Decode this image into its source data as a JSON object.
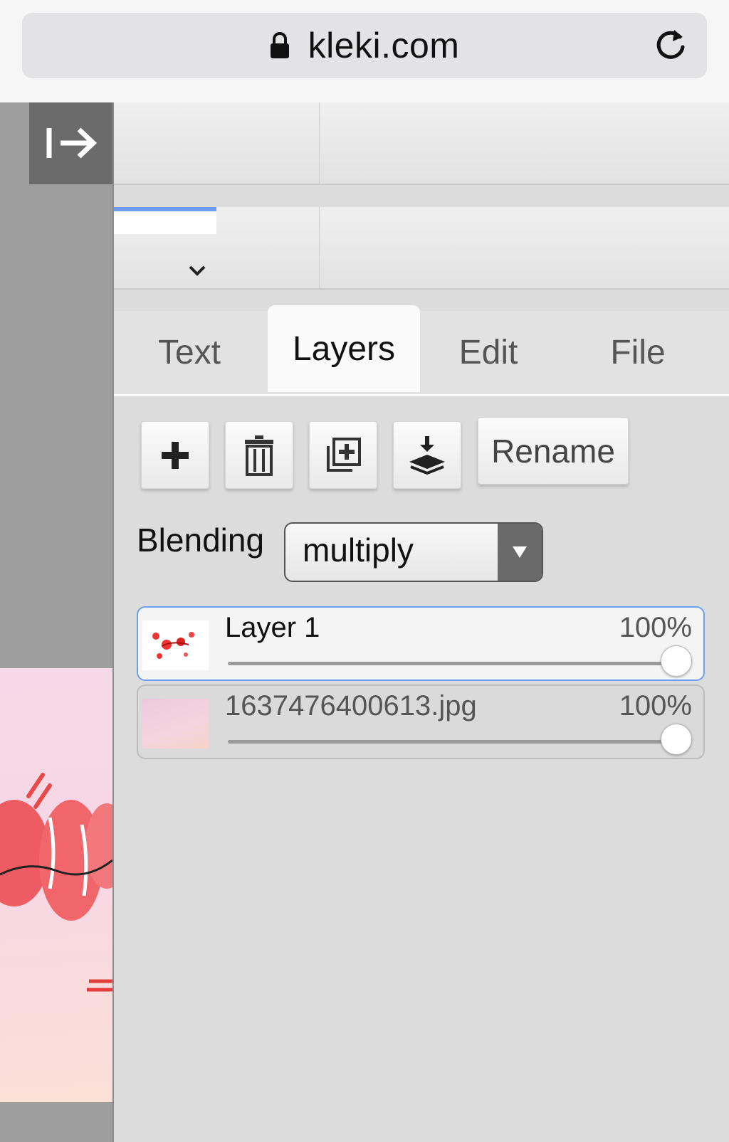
{
  "browser": {
    "url": "kleki.com"
  },
  "tabs": [
    {
      "label": "Text",
      "active": false
    },
    {
      "label": "Layers",
      "active": true
    },
    {
      "label": "Edit",
      "active": false
    },
    {
      "label": "File",
      "active": false
    }
  ],
  "layer_toolbar": {
    "icons": [
      "add-layer-icon",
      "delete-layer-icon",
      "duplicate-layer-icon",
      "merge-down-icon"
    ],
    "rename_label": "Rename"
  },
  "blending": {
    "label": "Blending",
    "value": "multiply"
  },
  "layers": [
    {
      "name": "Layer 1",
      "opacity": "100%",
      "opacity_value": 1.0,
      "selected": true
    },
    {
      "name": "1637476400613.jpg",
      "opacity": "100%",
      "opacity_value": 1.0,
      "selected": false
    }
  ],
  "colors": {
    "accent": "#6e9ef0",
    "panel": "#dcdcdc",
    "canvas_bg": "#9e9e9e"
  }
}
